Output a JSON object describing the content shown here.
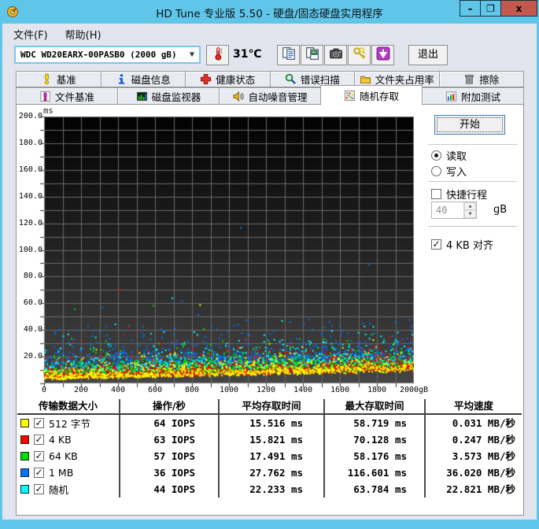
{
  "window": {
    "title": "HD Tune 专业版 5.50 - 硬盘/固态硬盘实用程序",
    "controls": {
      "minimize": "–",
      "maximize": "❐",
      "close": "x"
    }
  },
  "menu": {
    "items": [
      "文件(F)",
      "帮助(H)"
    ]
  },
  "toolbar": {
    "drive": "WDC WD20EARX-00PASB0  (2000 gB)",
    "temperature": "31℃",
    "buttons": [
      "copy-text-icon",
      "copy-image-icon",
      "camera-icon",
      "options-icon",
      "save-icon"
    ],
    "exit_label": "退出"
  },
  "tabs": {
    "row1": [
      {
        "label": "基准",
        "icon": "lightbulb-icon"
      },
      {
        "label": "磁盘信息",
        "icon": "info-icon"
      },
      {
        "label": "健康状态",
        "icon": "health-cross-icon"
      },
      {
        "label": "错误扫描",
        "icon": "magnifier-icon"
      },
      {
        "label": "文件夹占用率",
        "icon": "folder-icon"
      },
      {
        "label": "擦除",
        "icon": "trash-icon"
      }
    ],
    "row2": [
      {
        "label": "文件基准",
        "icon": "file-benchmark-icon"
      },
      {
        "label": "磁盘监视器",
        "icon": "monitor-chart-icon"
      },
      {
        "label": "自动噪音管理",
        "icon": "speaker-icon"
      },
      {
        "label": "随机存取",
        "icon": "scatter-icon",
        "active": true
      },
      {
        "label": "附加测试",
        "icon": "extra-tests-icon"
      }
    ]
  },
  "controls": {
    "start_label": "开始",
    "read_label": "读取",
    "write_label": "写入",
    "mode_selected": "read",
    "short_stroke": {
      "label": "快捷行程",
      "checked": false,
      "value": "40",
      "unit": "gB"
    },
    "align": {
      "label": "4 KB 对齐",
      "checked": true
    }
  },
  "chart_data": {
    "type": "scatter",
    "y_axis_label": "ms",
    "x_axis_unit": "gB",
    "xlim": [
      0,
      2000
    ],
    "ylim": [
      0,
      200
    ],
    "x_tick_step": 200,
    "y_tick_step": 20,
    "x_minor_step": 100,
    "y_minor_step": 10,
    "x_tick_labels": [
      "0",
      "200",
      "400",
      "600",
      "800",
      "1000",
      "1200",
      "1400",
      "1600",
      "1800",
      "2000gB"
    ],
    "y_tick_labels": [
      "20.0",
      "40.0",
      "60.0",
      "80.0",
      "100.0",
      "120.0",
      "140.0",
      "160.0",
      "180.0",
      "200.0"
    ],
    "grid": true,
    "background": {
      "top": "#020202",
      "bottom": "#454545"
    },
    "grid_color": "#6a6a6a",
    "seed": 1337,
    "draw_order": [
      3,
      4,
      2,
      1,
      0
    ],
    "series": [
      {
        "name": "512 字节",
        "color": "#ffff00",
        "iops": 64,
        "avg_ms": 15.516,
        "max_ms": 58.719,
        "avg_speed_mb_s": 0.031,
        "points": 1100,
        "band": {
          "min_start": 3.0,
          "min_end": 10.0,
          "spread": 3.8,
          "outlier_rate": 0.01,
          "outlier_extra": 25
        }
      },
      {
        "name": "4 KB",
        "color": "#ff0000",
        "iops": 63,
        "avg_ms": 15.821,
        "max_ms": 70.128,
        "avg_speed_mb_s": 0.247,
        "points": 1100,
        "band": {
          "min_start": 3.5,
          "min_end": 10.5,
          "spread": 4.0,
          "outlier_rate": 0.012,
          "outlier_extra": 30
        }
      },
      {
        "name": "64 KB",
        "color": "#00e000",
        "iops": 57,
        "avg_ms": 17.491,
        "max_ms": 58.176,
        "avg_speed_mb_s": 3.573,
        "points": 1000,
        "band": {
          "min_start": 5.0,
          "min_end": 12.0,
          "spread": 4.5,
          "outlier_rate": 0.015,
          "outlier_extra": 28
        }
      },
      {
        "name": "1 MB",
        "color": "#0073ff",
        "iops": 36,
        "avg_ms": 27.762,
        "max_ms": 116.601,
        "avg_speed_mb_s": 36.02,
        "points": 750,
        "band": {
          "min_start": 12.0,
          "min_end": 19.0,
          "spread": 7.0,
          "outlier_rate": 0.035,
          "outlier_extra": 32
        }
      },
      {
        "name": "随机",
        "color": "#00ffff",
        "iops": 44,
        "avg_ms": 22.233,
        "max_ms": 63.784,
        "avg_speed_mb_s": 22.821,
        "points": 850,
        "band": {
          "min_start": 8.0,
          "min_end": 15.0,
          "spread": 5.5,
          "outlier_rate": 0.025,
          "outlier_extra": 26
        }
      }
    ]
  },
  "results_table": {
    "headers": [
      "传输数据大小",
      "操作/秒",
      "平均存取时间",
      "最大存取时间",
      "平均速度"
    ],
    "rows": [
      {
        "color": "#ffff00",
        "label": "512 字节",
        "checked": true,
        "ops": "64 IOPS",
        "avg": "15.516 ms",
        "max": "58.719 ms",
        "speed": "0.031 MB/秒"
      },
      {
        "color": "#ff0000",
        "label": "4 KB",
        "checked": true,
        "ops": "63 IOPS",
        "avg": "15.821 ms",
        "max": "70.128 ms",
        "speed": "0.247 MB/秒"
      },
      {
        "color": "#00e000",
        "label": "64 KB",
        "checked": true,
        "ops": "57 IOPS",
        "avg": "17.491 ms",
        "max": "58.176 ms",
        "speed": "3.573 MB/秒"
      },
      {
        "color": "#0073ff",
        "label": "1 MB",
        "checked": true,
        "ops": "36 IOPS",
        "avg": "27.762 ms",
        "max": "116.601 ms",
        "speed": "36.020 MB/秒"
      },
      {
        "color": "#00ffff",
        "label": "随机",
        "checked": true,
        "ops": "44 IOPS",
        "avg": "22.233 ms",
        "max": "63.784 ms",
        "speed": "22.821 MB/秒"
      }
    ]
  }
}
